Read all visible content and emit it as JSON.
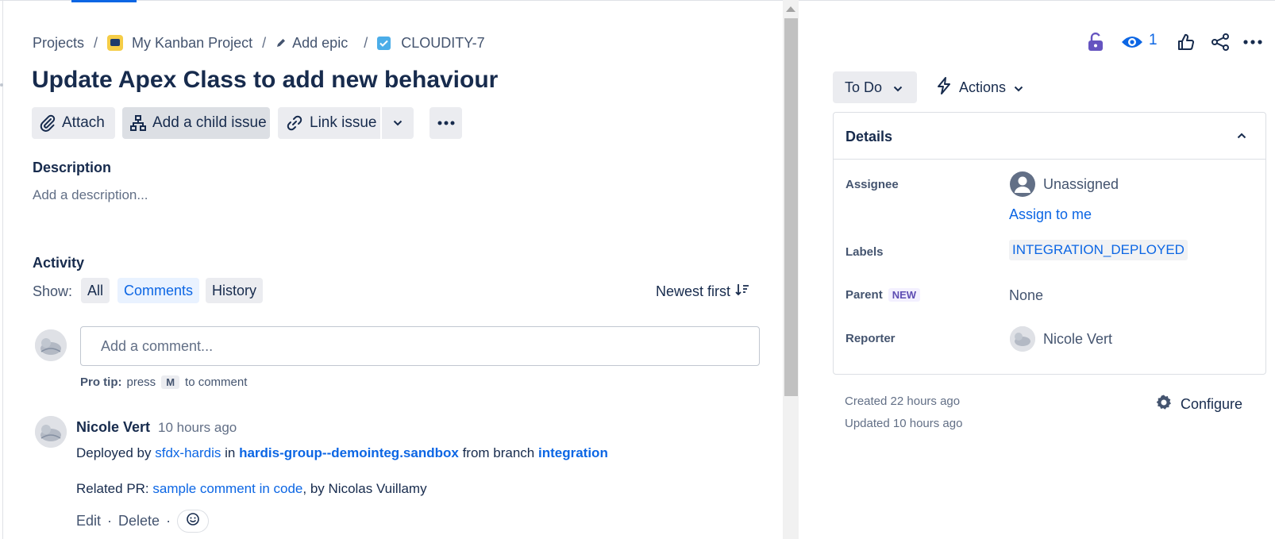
{
  "breadcrumb": {
    "projects": "Projects",
    "separator": "/",
    "project_name": "My Kanban Project",
    "add_epic": "Add epic",
    "issue_key": "CLOUDITY-7"
  },
  "issue": {
    "title": "Update Apex Class to add new behaviour"
  },
  "toolbar": {
    "attach": "Attach",
    "add_child": "Add a child issue",
    "link_issue": "Link issue"
  },
  "description": {
    "heading": "Description",
    "placeholder": "Add a description..."
  },
  "activity": {
    "heading": "Activity",
    "show_label": "Show:",
    "filters": [
      "All",
      "Comments",
      "History"
    ],
    "active_filter": "Comments",
    "sort_label": "Newest first",
    "comment_placeholder": "Add a comment...",
    "protip_bold": "Pro tip:",
    "protip_press": "press",
    "protip_key": "M",
    "protip_rest": "to comment"
  },
  "comment": {
    "author": "Nicole Vert",
    "time": "10 hours ago",
    "line1": {
      "deployed_by": "Deployed by",
      "bot": "sfdx-hardis",
      "in": "in",
      "org": "hardis-group--demointeg.sandbox",
      "from_branch": "from branch",
      "branch": "integration"
    },
    "line2": {
      "related": "Related PR:",
      "pr_link": "sample comment in code",
      "by": ", by Nicolas Vuillamy"
    },
    "edit": "Edit",
    "delete": "Delete",
    "dot": "·"
  },
  "right": {
    "watch_count": "1",
    "status": "To Do",
    "actions": "Actions",
    "details_title": "Details",
    "fields": {
      "assignee_label": "Assignee",
      "assignee_value": "Unassigned",
      "assign_to_me": "Assign to me",
      "labels_label": "Labels",
      "label_value": "INTEGRATION_DEPLOYED",
      "parent_label": "Parent",
      "parent_badge": "NEW",
      "parent_value": "None",
      "reporter_label": "Reporter",
      "reporter_value": "Nicole Vert"
    },
    "created": "Created 22 hours ago",
    "updated": "Updated 10 hours ago",
    "configure": "Configure"
  },
  "colors": {
    "brand_blue": "#0c66e4",
    "text": "#172b4d",
    "subtle": "#626f86",
    "lock_purple": "#6554c0"
  },
  "icons": [
    "pencil-icon",
    "task-icon",
    "attach-icon",
    "hierarchy-icon",
    "link-icon",
    "chevron-down-icon",
    "more-icon",
    "sort-icon",
    "emoji-icon",
    "lock-icon",
    "eye-icon",
    "like-icon",
    "share-icon",
    "lightning-icon",
    "chevron-up-icon",
    "user-icon",
    "gear-icon"
  ]
}
